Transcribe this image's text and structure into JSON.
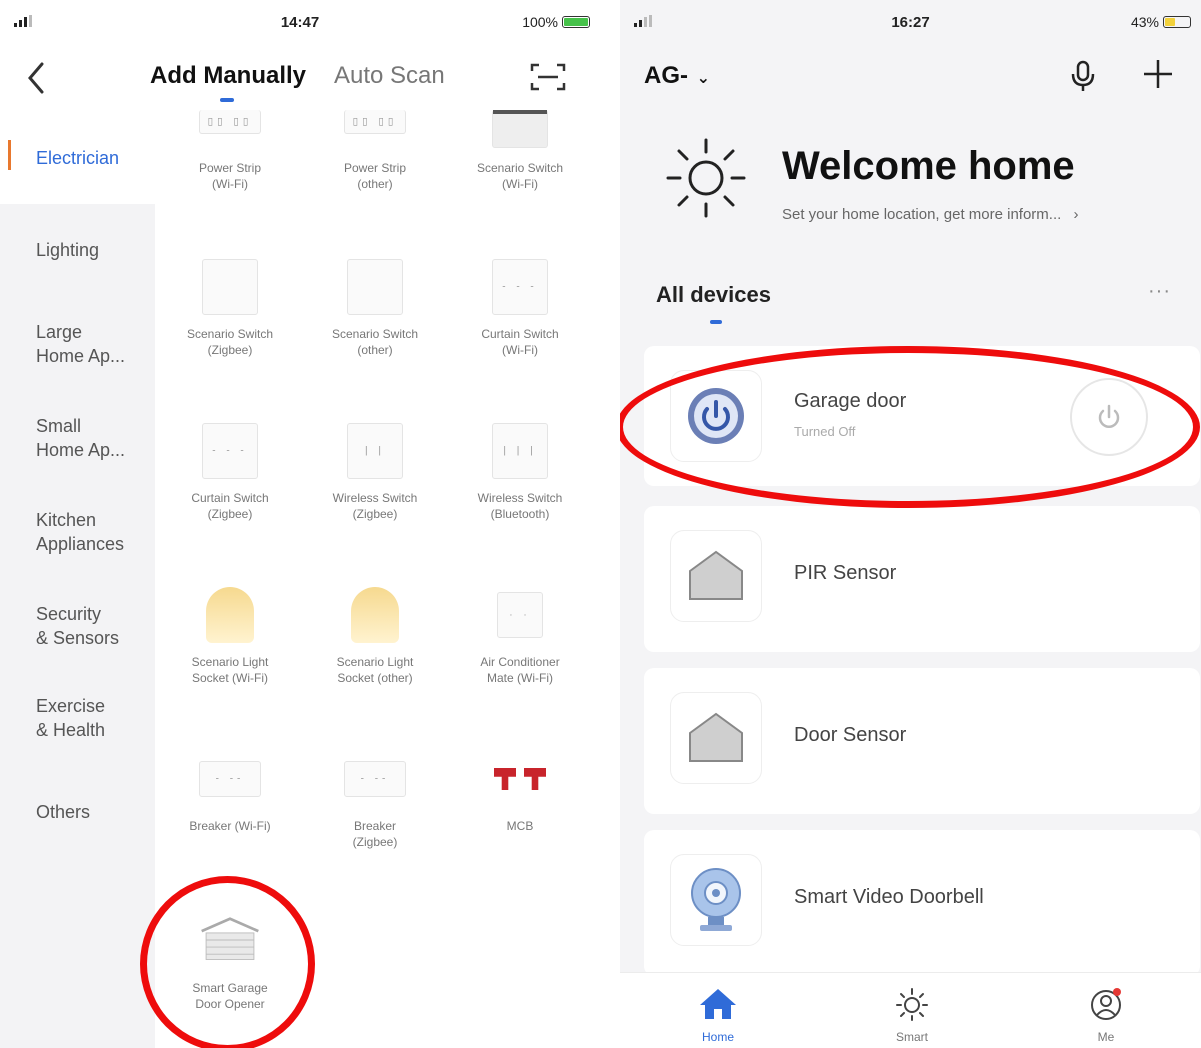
{
  "left": {
    "status_bar": {
      "time": "14:47",
      "battery": "100%"
    },
    "nav": {
      "tab_manual": "Add Manually",
      "tab_scan": "Auto Scan"
    },
    "categories": [
      "Electrician",
      "Lighting",
      "Large\nHome Ap...",
      "Small\nHome Ap...",
      "Kitchen\nAppliances",
      "Security\n& Sensors",
      "Exercise\n& Health",
      "Others"
    ],
    "devices": [
      {
        "label": "Power Strip\n(Wi-Fi)",
        "icon": "power-strip-icon"
      },
      {
        "label": "Power Strip\n(other)",
        "icon": "power-strip-icon"
      },
      {
        "label": "Scenario Switch\n(Wi-Fi)",
        "icon": "scenario-switch-icon"
      },
      {
        "label": "Scenario Switch\n(Zigbee)",
        "icon": "scenario-switch-icon"
      },
      {
        "label": "Scenario Switch\n(other)",
        "icon": "scenario-switch-icon"
      },
      {
        "label": "Curtain Switch\n(Wi-Fi)",
        "icon": "curtain-switch-icon"
      },
      {
        "label": "Curtain Switch\n(Zigbee)",
        "icon": "curtain-switch-icon"
      },
      {
        "label": "Wireless Switch\n(Zigbee)",
        "icon": "wireless-switch-icon"
      },
      {
        "label": "Wireless Switch\n(Bluetooth)",
        "icon": "wireless-switch-icon"
      },
      {
        "label": "Scenario Light\nSocket (Wi-Fi)",
        "icon": "light-socket-icon"
      },
      {
        "label": "Scenario Light\nSocket (other)",
        "icon": "light-socket-icon"
      },
      {
        "label": "Air Conditioner\nMate (Wi-Fi)",
        "icon": "ac-mate-icon"
      },
      {
        "label": "Breaker (Wi-Fi)",
        "icon": "breaker-icon"
      },
      {
        "label": "Breaker\n(Zigbee)",
        "icon": "breaker-icon"
      },
      {
        "label": "MCB",
        "icon": "mcb-icon"
      },
      {
        "label": "Smart Garage\nDoor Opener",
        "icon": "garage-door-icon"
      }
    ]
  },
  "right": {
    "status_bar": {
      "time": "16:27",
      "battery": "43%"
    },
    "home_name": "AG-",
    "welcome": {
      "title": "Welcome home",
      "subtitle": "Set your home location, get more inform..."
    },
    "section_title": "All devices",
    "devices": [
      {
        "name": "Garage door",
        "state": "Turned Off",
        "icon": "garage-power-icon"
      },
      {
        "name": "PIR Sensor",
        "icon": "house-sensor-icon"
      },
      {
        "name": "Door Sensor",
        "icon": "house-sensor-icon"
      },
      {
        "name": "Smart Video Doorbell",
        "icon": "doorbell-camera-icon"
      }
    ],
    "tabs": [
      {
        "label": "Home",
        "icon": "home-icon"
      },
      {
        "label": "Smart",
        "icon": "sun-icon"
      },
      {
        "label": "Me",
        "icon": "user-icon"
      }
    ]
  },
  "colors": {
    "accent": "#2f6bd8",
    "annotation": "#ee0c0c",
    "battery_left": "#46c24a",
    "battery_right": "#f2d13b"
  }
}
